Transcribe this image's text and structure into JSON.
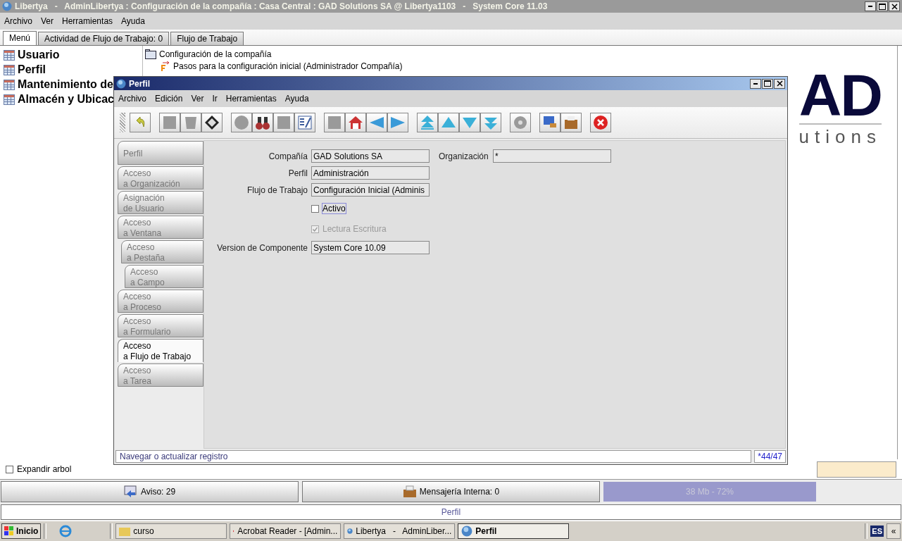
{
  "window": {
    "title": "Libertya   -   AdminLibertya : Configuración de la compañía : Casa Central : GAD Solutions SA @ Libertya1103   -   System Core 11.03"
  },
  "menu": [
    "Archivo",
    "Ver",
    "Herramientas",
    "Ayuda"
  ],
  "tabs": [
    {
      "label": "Menú",
      "selected": true
    },
    {
      "label": "Actividad de Flujo de Trabajo: 0",
      "selected": false
    },
    {
      "label": "Flujo de Trabajo",
      "selected": false
    }
  ],
  "favorites": [
    "Usuario",
    "Perfil",
    "Mantenimiento de",
    "Almacén y Ubicac"
  ],
  "tree": [
    {
      "label": "Configuración de la compañía",
      "kind": "folder",
      "children": [
        {
          "label": "Pasos para la configuración inicial (Administrador Compañía)",
          "kind": "workflow"
        }
      ]
    }
  ],
  "logo": {
    "top": "AD",
    "bottom": "utions"
  },
  "expand_tree": {
    "label": "Expandir arbol",
    "checked": false
  },
  "dialog": {
    "title": "Perfil",
    "menu": [
      "Archivo",
      "Edición",
      "Ver",
      "Ir",
      "Herramientas",
      "Ayuda"
    ],
    "side_tabs": [
      {
        "lines": [
          "Perfil"
        ],
        "selected": false
      },
      {
        "lines": [
          "Acceso",
          "a Organización"
        ],
        "selected": false
      },
      {
        "lines": [
          "Asignación",
          "de Usuario"
        ],
        "selected": false
      },
      {
        "lines": [
          "Acceso",
          "a Ventana"
        ],
        "selected": false,
        "children": [
          {
            "lines": [
              "Acceso",
              "a Pestaña"
            ],
            "selected": false,
            "children": [
              {
                "lines": [
                  "Acceso",
                  "a Campo"
                ],
                "selected": false
              }
            ]
          }
        ]
      },
      {
        "lines": [
          "Acceso",
          "a Proceso"
        ],
        "selected": false
      },
      {
        "lines": [
          "Acceso",
          "a Formulario"
        ],
        "selected": false
      },
      {
        "lines": [
          "Acceso",
          "a Flujo de Trabajo"
        ],
        "selected": true
      },
      {
        "lines": [
          "Acceso",
          "a Tarea"
        ],
        "selected": false
      }
    ],
    "fields": [
      {
        "kind": "text",
        "label": "Compañía",
        "value": "GAD Solutions SA"
      },
      {
        "kind": "text",
        "label": "Organización",
        "value": "*"
      },
      {
        "kind": "text",
        "label": "Perfil",
        "value": "Administración"
      },
      {
        "kind": "text",
        "label": "Flujo de Trabajo",
        "value": "Configuración Inicial (Adminis"
      },
      {
        "kind": "checkbox",
        "label": "Activo",
        "checked": false,
        "focused": true,
        "disabled": false
      },
      {
        "kind": "checkbox",
        "label": "Lectura Escritura",
        "checked": true,
        "focused": false,
        "disabled": true
      },
      {
        "kind": "text",
        "label": "Version de Componente",
        "value": "System Core 10.09"
      }
    ],
    "status": "Navegar o actualizar registro",
    "record": "*44/47"
  },
  "notice": "Aviso: 29",
  "messages": "Mensajería Interna: 0",
  "memory": "38 Mb - 72%",
  "footer": "Perfil",
  "taskbar": {
    "start": "Inicio",
    "items": [
      {
        "label": "curso",
        "kind": "folder",
        "selected": false
      },
      {
        "label": "Acrobat Reader - [Admin...",
        "kind": "pdf",
        "selected": false
      },
      {
        "label": "Libertya   -   AdminLiber...",
        "kind": "app",
        "selected": false
      },
      {
        "label": "Perfil",
        "kind": "app",
        "selected": true
      }
    ],
    "language": "ES",
    "collapse": "«"
  }
}
